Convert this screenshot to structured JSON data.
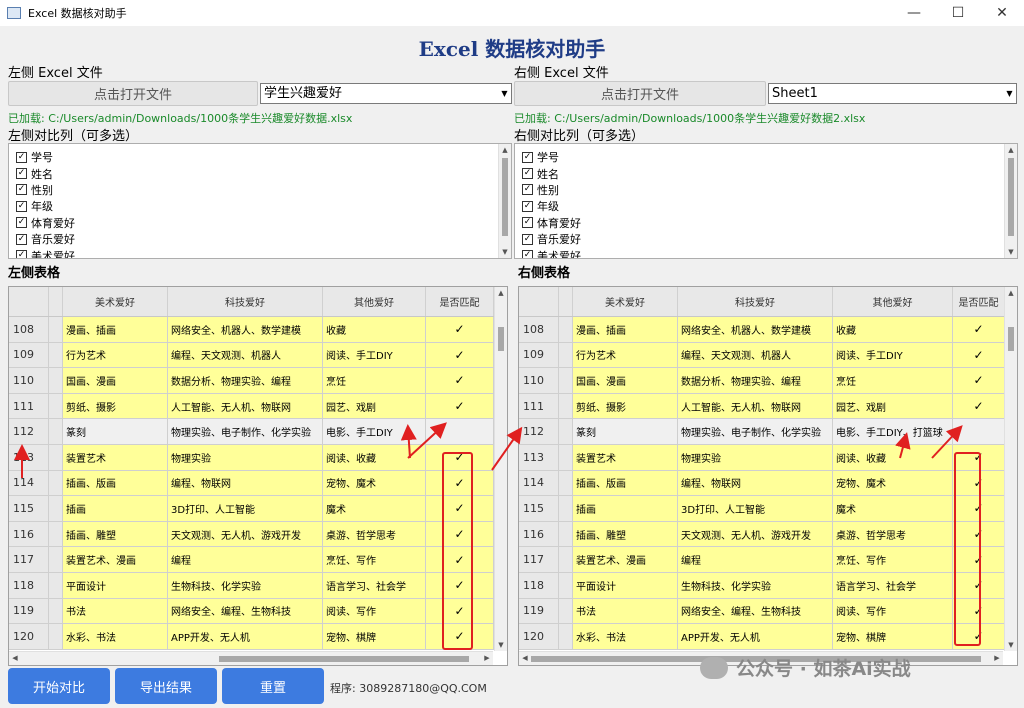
{
  "window": {
    "title": "Excel 数据核对助手",
    "minimize": "—",
    "maximize": "☐",
    "close": "✕"
  },
  "heading": "Excel 数据核对助手",
  "left": {
    "file_label": "左侧 Excel 文件",
    "open_button": "点击打开文件",
    "sheet": "学生兴趣爱好",
    "loaded": "已加载: C:/Users/admin/Downloads/1000条学生兴趣爱好数据.xlsx",
    "compare_label": "左侧对比列（可多选）",
    "columns": [
      "学号",
      "姓名",
      "性别",
      "年级",
      "体育爱好",
      "音乐爱好",
      "美术爱好"
    ],
    "table_title": "左侧表格"
  },
  "right": {
    "file_label": "右侧 Excel 文件",
    "open_button": "点击打开文件",
    "sheet": "Sheet1",
    "loaded": "已加载: C:/Users/admin/Downloads/1000条学生兴趣爱好数据2.xlsx",
    "compare_label": "右侧对比列（可多选）",
    "columns": [
      "学号",
      "姓名",
      "性别",
      "年级",
      "体育爱好",
      "音乐爱好",
      "美术爱好"
    ],
    "table_title": "右侧表格"
  },
  "table_headers": [
    "美术爱好",
    "科技爱好",
    "其他爱好",
    "是否匹配"
  ],
  "left_rows": [
    [
      "108",
      "漫画、插画",
      "网络安全、机器人、数学建模",
      "收藏",
      "✓"
    ],
    [
      "109",
      "行为艺术",
      "编程、天文观测、机器人",
      "阅读、手工DIY",
      "✓"
    ],
    [
      "110",
      "国画、漫画",
      "数据分析、物理实验、编程",
      "烹饪",
      "✓"
    ],
    [
      "111",
      "剪纸、摄影",
      "人工智能、无人机、物联网",
      "园艺、戏剧",
      "✓"
    ],
    [
      "112",
      "篆刻",
      "物理实验、电子制作、化学实验",
      "电影、手工DIY",
      ""
    ],
    [
      "113",
      "装置艺术",
      "物理实验",
      "阅读、收藏",
      "✓"
    ],
    [
      "114",
      "插画、版画",
      "编程、物联网",
      "宠物、魔术",
      "✓"
    ],
    [
      "115",
      "插画",
      "3D打印、人工智能",
      "魔术",
      "✓"
    ],
    [
      "116",
      "插画、雕塑",
      "天文观测、无人机、游戏开发",
      "桌游、哲学思考",
      "✓"
    ],
    [
      "117",
      "装置艺术、漫画",
      "编程",
      "烹饪、写作",
      "✓"
    ],
    [
      "118",
      "平面设计",
      "生物科技、化学实验",
      "语言学习、社会学",
      "✓"
    ],
    [
      "119",
      "书法",
      "网络安全、编程、生物科技",
      "阅读、写作",
      "✓"
    ],
    [
      "120",
      "水彩、书法",
      "APP开发、无人机",
      "宠物、棋牌",
      "✓"
    ]
  ],
  "right_rows": [
    [
      "108",
      "漫画、插画",
      "网络安全、机器人、数学建模",
      "收藏",
      "✓"
    ],
    [
      "109",
      "行为艺术",
      "编程、天文观测、机器人",
      "阅读、手工DIY",
      "✓"
    ],
    [
      "110",
      "国画、漫画",
      "数据分析、物理实验、编程",
      "烹饪",
      "✓"
    ],
    [
      "111",
      "剪纸、摄影",
      "人工智能、无人机、物联网",
      "园艺、戏剧",
      "✓"
    ],
    [
      "112",
      "篆刻",
      "物理实验、电子制作、化学实验",
      "电影、手工DIY、打篮球",
      ""
    ],
    [
      "113",
      "装置艺术",
      "物理实验",
      "阅读、收藏",
      "✓"
    ],
    [
      "114",
      "插画、版画",
      "编程、物联网",
      "宠物、魔术",
      "✓"
    ],
    [
      "115",
      "插画",
      "3D打印、人工智能",
      "魔术",
      "✓"
    ],
    [
      "116",
      "插画、雕塑",
      "天文观测、无人机、游戏开发",
      "桌游、哲学思考",
      "✓"
    ],
    [
      "117",
      "装置艺术、漫画",
      "编程",
      "烹饪、写作",
      "✓"
    ],
    [
      "118",
      "平面设计",
      "生物科技、化学实验",
      "语言学习、社会学",
      "✓"
    ],
    [
      "119",
      "书法",
      "网络安全、编程、生物科技",
      "阅读、写作",
      "✓"
    ],
    [
      "120",
      "水彩、书法",
      "APP开发、无人机",
      "宠物、棋牌",
      "✓"
    ]
  ],
  "actions": {
    "start": "开始对比",
    "export": "导出结果",
    "reset": "重置"
  },
  "contact": "程序: 3089287180@QQ.COM",
  "watermark": "公众号 · 如茶Ai实战",
  "colors": {
    "match_row": "#ffff99",
    "mismatch_row": "#f0f0f0",
    "action_button": "#3d7be0",
    "loaded_text": "#1a8a2a",
    "annotation": "#e02020",
    "heading": "#1f3c86"
  }
}
